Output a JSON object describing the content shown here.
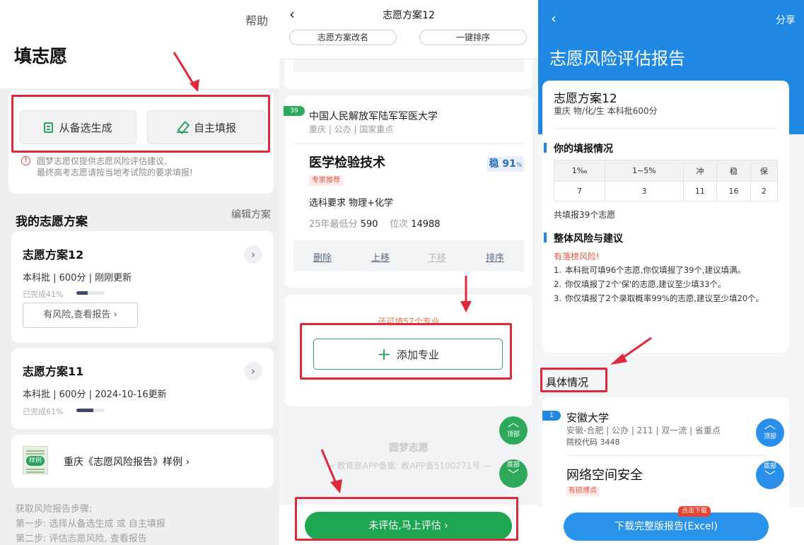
{
  "panel1": {
    "help": "帮助",
    "title": "填志愿",
    "gen_from_candidates": "从备选生成",
    "self_fill": "自主填报",
    "disclaimer_line1": "圆梦志愿仅提供志愿风险评估建议,",
    "disclaimer_line2": "最终高考志愿请按当地考试院的要求填报!",
    "my_plans_title": "我的志愿方案",
    "edit_plans": "编辑方案",
    "plans": [
      {
        "name": "志愿方案12",
        "meta": "本科批 | 600分 | 刚刚更新",
        "progress_text": "已完成41%",
        "progress": 0.41,
        "risk_button": "有风险,查看报告 ›"
      },
      {
        "name": "志愿方案11",
        "meta": "本科批 | 600分 | 2024-10-16更新",
        "progress_text": "已完成61%",
        "progress": 0.61
      }
    ],
    "sample_badge": "样例",
    "sample_text": "重庆《志愿风险报告》样例 ›",
    "steps_title": "获取风险报告步骤:",
    "step1": "第一步: 选择从备选生成 或 自主填报",
    "step2": "第二步: 评估志愿风险, 查看报告"
  },
  "panel2": {
    "title": "志愿方案12",
    "rename": "志愿方案改名",
    "one_click_sort": "一键排序",
    "rank_tag": "39",
    "university": "中国人民解放军陆军军医大学",
    "uni_meta": "重庆 | 公办 | 国家重点",
    "major": "医学检验技术",
    "expert_tag": "专家推荐",
    "stable_label": "稳",
    "stable_value": "91",
    "stable_unit": "%",
    "subject_req": "选科要求 物理+化学",
    "score_label": "25年最低分",
    "score_value": "590",
    "rank_label": "位次",
    "rank_value": "14988",
    "actions": [
      "删除",
      "上移",
      "下移",
      "排序"
    ],
    "remain": "还可填57个专业",
    "add_major": "添加专业",
    "top_label": "顶部",
    "bottom_label": "底部",
    "watermark_brand": "圆梦志愿",
    "watermark_record": "— 教育部APP备案: 教APP备5100271号 —",
    "evaluate": "未评估,马上评估 ›"
  },
  "panel3": {
    "share": "分享",
    "title": "志愿风险评估报告",
    "plan_name": "志愿方案12",
    "plan_meta": "重庆 物/化/生 本科批600分",
    "fill_status_title": "你的填报情况",
    "table_headers": [
      "1‰",
      "1~5%",
      "冲",
      "稳",
      "保"
    ],
    "table_values": [
      "7",
      "3",
      "11",
      "16",
      "2"
    ],
    "total": "共填报39个志愿",
    "overall_title": "整体风险与建议",
    "risk_warning": "有落榜风险!",
    "advice": [
      "本科批可填96个志愿,你仅填报了39个,建议填满。",
      "你仅填报了2个'保'的志愿,建议至少填33个。",
      "你仅填报了2个录取概率99%的志愿,建议至少填20个。"
    ],
    "detail_title": "具体情况",
    "detail_num": "1",
    "detail_university": "安徽大学",
    "detail_meta": "安徽-合肥 | 公办 | 211 | 双一流 | 省重点",
    "detail_code": "院校代码 3448",
    "detail_major": "网络空间安全",
    "detail_tag": "有硕博点",
    "top_label": "顶部",
    "bottom_label": "底部",
    "download_badge": "点击下载",
    "download": "下载完整版报告(Excel)"
  }
}
